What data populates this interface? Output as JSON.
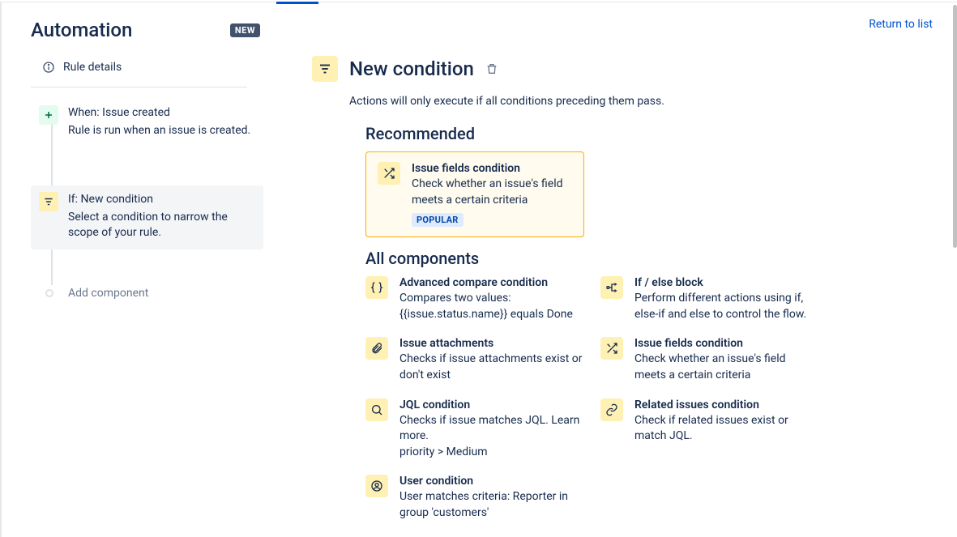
{
  "header": {
    "title": "Automation",
    "new_badge": "NEW",
    "return_link": "Return to list"
  },
  "sidebar": {
    "rule_details_label": "Rule details",
    "steps": [
      {
        "title": "When: Issue created",
        "desc": "Rule is run when an issue is created."
      },
      {
        "title": "If: New condition",
        "desc": "Select a condition to narrow the scope of your rule."
      }
    ],
    "add_component_label": "Add component"
  },
  "main": {
    "title": "New condition",
    "subtitle": "Actions will only execute if all conditions preceding them pass.",
    "recommended_heading": "Recommended",
    "recommended": {
      "title": "Issue fields condition",
      "desc": "Check whether an issue's field meets a certain criteria",
      "badge": "POPULAR"
    },
    "all_components_heading": "All components",
    "components": [
      {
        "icon": "braces",
        "title": "Advanced compare condition",
        "desc": "Compares two values: {{issue.status.name}} equals Done"
      },
      {
        "icon": "branch",
        "title": "If / else block",
        "desc": "Perform different actions using if, else-if and else to control the flow."
      },
      {
        "icon": "attachment",
        "title": "Issue attachments",
        "desc": "Checks if issue attachments exist or don't exist"
      },
      {
        "icon": "shuffle",
        "title": "Issue fields condition",
        "desc": "Check whether an issue's field meets a certain criteria"
      },
      {
        "icon": "search",
        "title": "JQL condition",
        "desc": "Checks if issue matches JQL. Learn more.\npriority > Medium"
      },
      {
        "icon": "link",
        "title": "Related issues condition",
        "desc": "Check if related issues exist or match JQL."
      },
      {
        "icon": "user",
        "title": "User condition",
        "desc": "User matches criteria: Reporter in group 'customers'"
      }
    ]
  }
}
